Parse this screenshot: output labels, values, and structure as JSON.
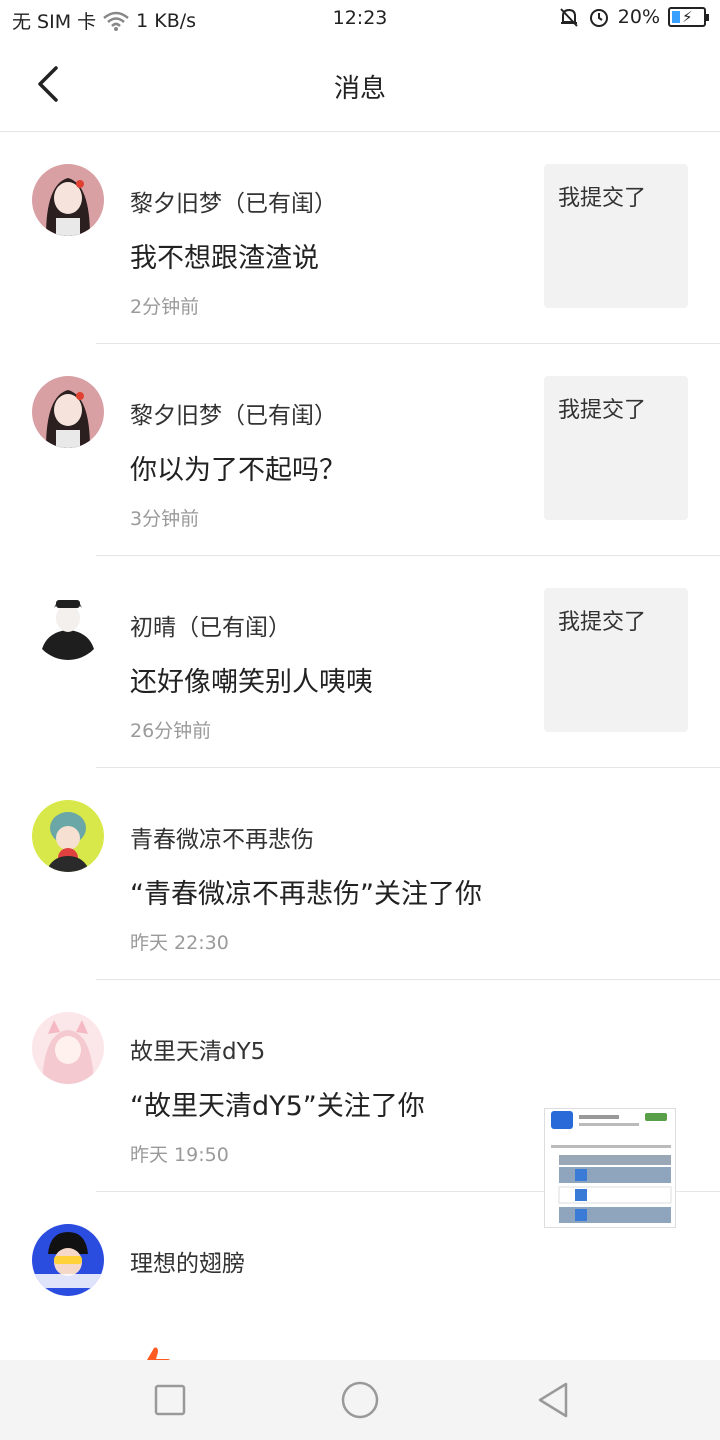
{
  "status_bar": {
    "carrier": "无 SIM 卡",
    "speed": "1 KB/s",
    "time": "12:23",
    "battery": "20%",
    "battery_level": 0.2
  },
  "header": {
    "title": "消息"
  },
  "messages": [
    {
      "name": "黎夕旧梦（已有闺）",
      "content": "我不想跟渣渣说",
      "time": "2分钟前",
      "thumb_text": "我提交了"
    },
    {
      "name": "黎夕旧梦（已有闺）",
      "content": "你以为了不起吗？",
      "time": "3分钟前",
      "thumb_text": "我提交了"
    },
    {
      "name": "初晴（已有闺）",
      "content": "还好像嘲笑别人咦咦",
      "time": "26分钟前",
      "thumb_text": "我提交了"
    },
    {
      "name": "青春微凉不再悲伤",
      "content": "“青春微凉不再悲伤”关注了你",
      "time": "昨天 22:30"
    },
    {
      "name": "故里天清dY5",
      "content": "“故里天清dY5”关注了你",
      "time": "昨天 19:50"
    },
    {
      "name": "理想的翅膀"
    }
  ],
  "icons": {
    "back": "chevron-left-icon",
    "like": "thumbs-up-icon",
    "nav_recent": "square-icon",
    "nav_home": "circle-icon",
    "nav_back": "triangle-back-icon"
  },
  "colors": {
    "like": "#ff5a1f",
    "battery_fill": "#3aa0ff",
    "thumb_bg": "#f2f2f2"
  }
}
